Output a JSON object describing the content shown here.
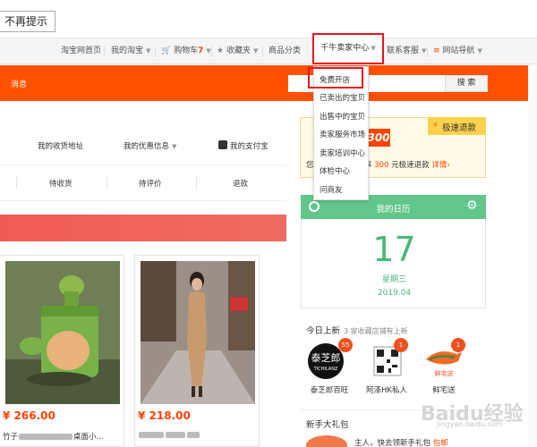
{
  "topbar": {
    "no_remind_label": "不再提示"
  },
  "site_nav": {
    "items": [
      {
        "label": "淘宝网首页"
      },
      {
        "label": "我的淘宝"
      },
      {
        "label": "购物车",
        "count": "7"
      },
      {
        "label": "收藏夹"
      },
      {
        "label": "商品分类"
      },
      {
        "label": "千牛卖家中心"
      },
      {
        "label": "联系客服"
      },
      {
        "label": "网站导航"
      }
    ]
  },
  "header": {
    "messages_label": "消息",
    "search": {
      "placeholder": "",
      "button_label": "搜 索"
    }
  },
  "seller_dropdown": {
    "items": [
      {
        "label": "免费开店"
      },
      {
        "label": "已卖出的宝贝"
      },
      {
        "label": "出售中的宝贝"
      },
      {
        "label": "卖家服务市场"
      },
      {
        "label": "卖家培训中心"
      },
      {
        "label": "体检中心"
      },
      {
        "label": "问商友"
      }
    ]
  },
  "account": {
    "address_link": "我的收货地址",
    "coupon_link": "我的优惠信息",
    "alipay_link": "我的支付宝"
  },
  "orders": {
    "tabs": [
      {
        "label": "待收货"
      },
      {
        "label": "待评价"
      },
      {
        "label": "退款"
      }
    ]
  },
  "products": [
    {
      "price": "¥ 266.00",
      "title_visible": "竹子",
      "title_tail": "桌面小..."
    },
    {
      "price": "¥ 218.00",
      "title_visible": "",
      "title_tail": ""
    }
  ],
  "promo": {
    "flag_label": "极速退款",
    "amount": "300",
    "line_prefix": "您",
    "line_mid": "尊享",
    "line_amount": "300",
    "line_suffix": "元极速退款",
    "details_link": "详情›"
  },
  "calendar": {
    "title": "我的日历",
    "day": "17",
    "weekday": "星期三",
    "year_month": "2019.04"
  },
  "new_shops": {
    "title": "今日上新",
    "subtitle": "3 家收藏店铺有上新",
    "shops": [
      {
        "name": "泰芝郎百旺",
        "badge": "55",
        "logo_text": "泰芝郎",
        "logo_sub": "TICHILANZ"
      },
      {
        "name": "阿泽HK私人",
        "badge": "1",
        "logo_text": "",
        "logo_sub": ""
      },
      {
        "name": "鲜宅送",
        "badge": "1",
        "logo_text": "鲜宅送",
        "logo_sub": ""
      }
    ]
  },
  "gift": {
    "title": "新手大礼包",
    "text_prefix": "主人，快去领新手礼包",
    "text_suffix": "包邮"
  },
  "watermark": {
    "main": "Baidu经验",
    "sub": "jingyan.baidu.com"
  },
  "colors": {
    "brand_orange": "#ff5000",
    "accent_red": "#f40",
    "calendar_green": "#62c68b",
    "highlight_box": "#e8131a"
  }
}
